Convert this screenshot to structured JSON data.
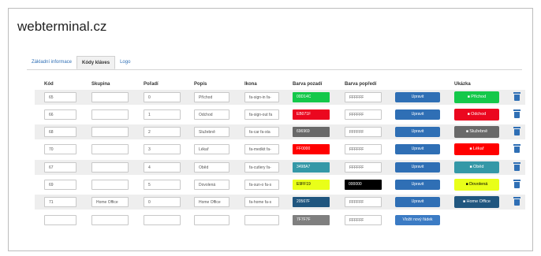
{
  "app": {
    "title": "webterminal.cz"
  },
  "tabs": [
    {
      "label": "Základní informace",
      "active": false
    },
    {
      "label": "Kódy kláves",
      "active": true
    },
    {
      "label": "Logo",
      "active": false
    }
  ],
  "table": {
    "headers": {
      "kod": "Kód",
      "skupina": "Skupina",
      "poradi": "Pořadí",
      "popis": "Popis",
      "ikona": "Ikona",
      "barva_pozadi": "Barva pozadí",
      "barva_popredi": "Barva popředí",
      "ukazka": "Ukázka"
    },
    "rows": [
      {
        "kod": "65",
        "skupina": "",
        "poradi": "0",
        "popis": "Příchod",
        "ikona": "fa-sign-in fa-",
        "bg": "00D14C",
        "fg": "FFFFFF",
        "bg_color": "#14c84a",
        "fg_color": "#ffffff",
        "action": "Upravit",
        "preview": "Příchod",
        "preview_icon": "sign-in-icon"
      },
      {
        "kod": "66",
        "skupina": "",
        "poradi": "1",
        "popis": "Odchod",
        "ikona": "fa-sign-out fa",
        "bg": "EB071F",
        "fg": "FFFFFF",
        "bg_color": "#eb071f",
        "fg_color": "#ffffff",
        "action": "Upravit",
        "preview": "Odchod",
        "preview_icon": "sign-out-icon"
      },
      {
        "kod": "68",
        "skupina": "",
        "poradi": "2",
        "popis": "Služebně",
        "ikona": "fa-car fa-sta",
        "bg": "696969",
        "fg": "FFFFFF",
        "bg_color": "#696969",
        "fg_color": "#ffffff",
        "action": "Upravit",
        "preview": "Služebně",
        "preview_icon": "car-icon"
      },
      {
        "kod": "70",
        "skupina": "",
        "poradi": "3",
        "popis": "Lékař",
        "ikona": "fa-medkit fa-",
        "bg": "FF0000",
        "fg": "FFFFFF",
        "bg_color": "#ff0000",
        "fg_color": "#ffffff",
        "action": "Upravit",
        "preview": "Lékař",
        "preview_icon": "medkit-icon"
      },
      {
        "kod": "67",
        "skupina": "",
        "poradi": "4",
        "popis": "Oběd",
        "ikona": "fa-cutlery fa-",
        "bg": "3498A7",
        "fg": "FFFFFF",
        "bg_color": "#3498a7",
        "fg_color": "#ffffff",
        "action": "Upravit",
        "preview": "Oběd",
        "preview_icon": "cutlery-icon"
      },
      {
        "kod": "69",
        "skupina": "",
        "poradi": "5",
        "popis": "Dovolená",
        "ikona": "fa-sun-o fa-s",
        "bg": "E9FF19",
        "fg": "000000",
        "bg_color": "#e9ff19",
        "fg_color": "#000000",
        "action": "Upravit",
        "preview": "Dovolená",
        "preview_icon": "sun-icon"
      },
      {
        "kod": "71",
        "skupina": "Home Office",
        "poradi": "0",
        "popis": "Home Office",
        "ikona": "fa-home fa-s",
        "bg": "20567F",
        "fg": "FFFFFF",
        "bg_color": "#20567f",
        "fg_color": "#ffffff",
        "action": "Upravit",
        "preview": "Home Office",
        "preview_icon": "home-icon"
      }
    ],
    "new_row": {
      "bg": "7F7F7F",
      "fg": "FFFFFF",
      "bg_color": "#7f7f7f",
      "fg_color": "#ffffff",
      "action": "Vložit nový řádek"
    }
  },
  "colors": {
    "accent": "#2f6fb5"
  }
}
